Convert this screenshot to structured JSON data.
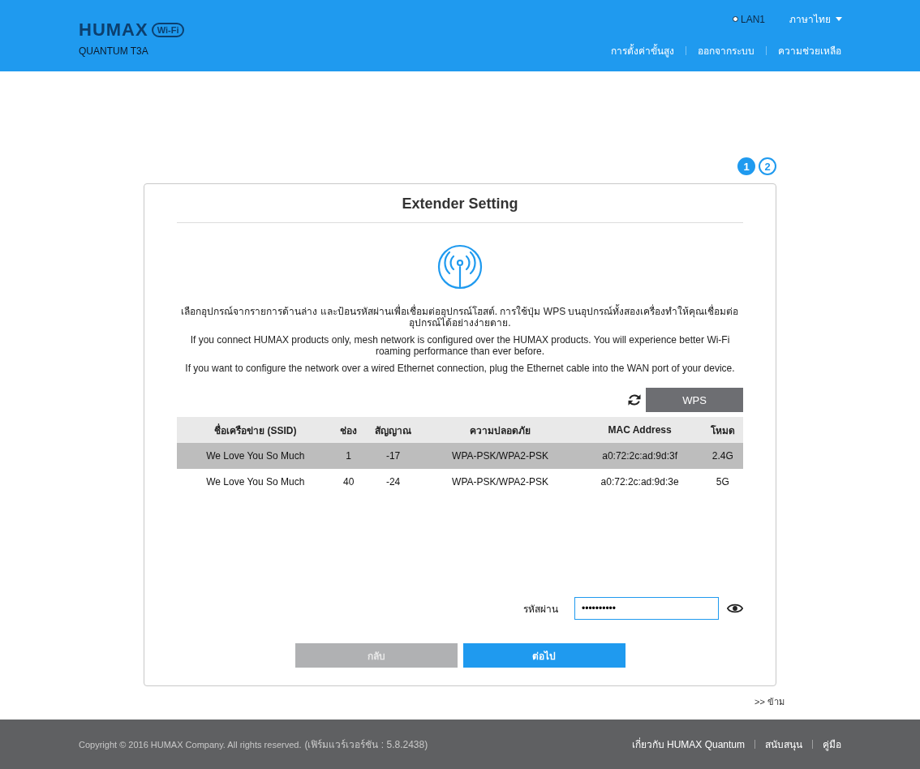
{
  "header": {
    "logo": "HUMAX",
    "logo_badge": "Wi-Fi",
    "model": "QUANTUM T3A",
    "lan": {
      "label": "LAN1",
      "connected": false
    },
    "language": "ภาษาไทย",
    "nav": [
      "การตั้งค่าขั้นสูง",
      "ออกจากระบบ",
      "ความช่วยเหลือ"
    ]
  },
  "steps": [
    {
      "label": "1",
      "selected": true
    },
    {
      "label": "2",
      "selected": false
    }
  ],
  "card": {
    "title": "Extender Setting",
    "paragraphs": [
      "เลือกอุปกรณ์จากรายการด้านล่าง และป้อนรหัสผ่านเพื่อเชื่อมต่ออุปกรณ์โฮสต์. การใช้ปุ่ม WPS บนอุปกรณ์ทั้งสองเครื่องทำให้คุณเชื่อมต่ออุปกรณ์ได้อย่างง่ายดาย.",
      "If you connect HUMAX products only, mesh network is configured over the HUMAX products. You will experience better Wi-Fi roaming performance than ever before.",
      "If you want to configure the network over a wired Ethernet connection, plug the Ethernet cable into the WAN port of your device."
    ],
    "wps_button": "WPS",
    "table": {
      "columns": [
        "ชื่อเครือข่าย (SSID)",
        "ช่อง",
        "สัญญาณ",
        "ความปลอดภัย",
        "MAC Address",
        "โหมด"
      ],
      "rows": [
        {
          "cells": [
            "We Love You So Much",
            "1",
            "-17",
            "WPA-PSK/WPA2-PSK",
            "a0:72:2c:ad:9d:3f",
            "2.4G"
          ],
          "selected": true
        },
        {
          "cells": [
            "We Love You So Much",
            "40",
            "-24",
            "WPA-PSK/WPA2-PSK",
            "a0:72:2c:ad:9d:3e",
            "5G"
          ],
          "selected": false
        }
      ]
    },
    "password": {
      "label": "รหัสผ่าน",
      "value": "••••••••••"
    },
    "back_button": {
      "label": "กลับ",
      "disabled": true
    },
    "next_button": {
      "label": "ต่อไป",
      "disabled": false
    }
  },
  "skip_link": ">> ข้าม",
  "footer": {
    "copyright": "Copyright © 2016 HUMAX Company. All rights reserved.",
    "firmware": "(เฟิร์มแวร์เวอร์ชัน : 5.8.2438)",
    "links": [
      "เกี่ยวกับ HUMAX Quantum",
      "สนับสนุน",
      "คู่มือ"
    ]
  }
}
